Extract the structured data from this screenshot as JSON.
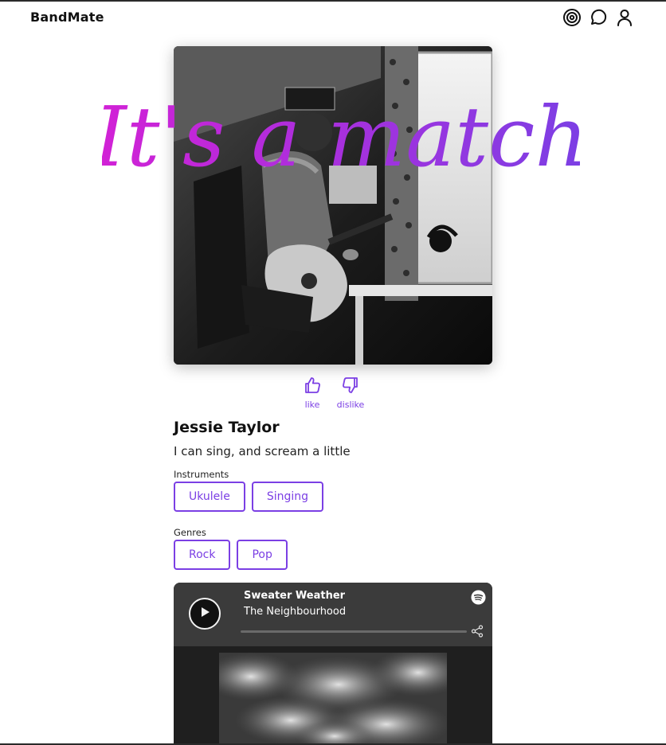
{
  "app": {
    "brand": "BandMate"
  },
  "nav": {
    "icons": [
      "target-icon",
      "chat-bubble-icon",
      "user-profile-icon"
    ]
  },
  "match": {
    "banner_text": "It's a match"
  },
  "reactions": {
    "like_label": "like",
    "dislike_label": "dislike"
  },
  "profile": {
    "name": "Jessie Taylor",
    "bio": "I can sing, and scream a little",
    "instruments_label": "Instruments",
    "instruments": [
      "Ukulele",
      "Singing"
    ],
    "genres_label": "Genres",
    "genres": [
      "Rock",
      "Pop"
    ]
  },
  "spotify": {
    "track_title": "Sweater Weather",
    "artist": "The Neighbourhood",
    "progress": 0
  },
  "colors": {
    "accent": "#7b3fe4",
    "banner_gradient_start": "#d321d6",
    "banner_gradient_end": "#7b3fe4",
    "embed_bg": "#1f1f1f",
    "embed_top": "#3b3b3b"
  }
}
